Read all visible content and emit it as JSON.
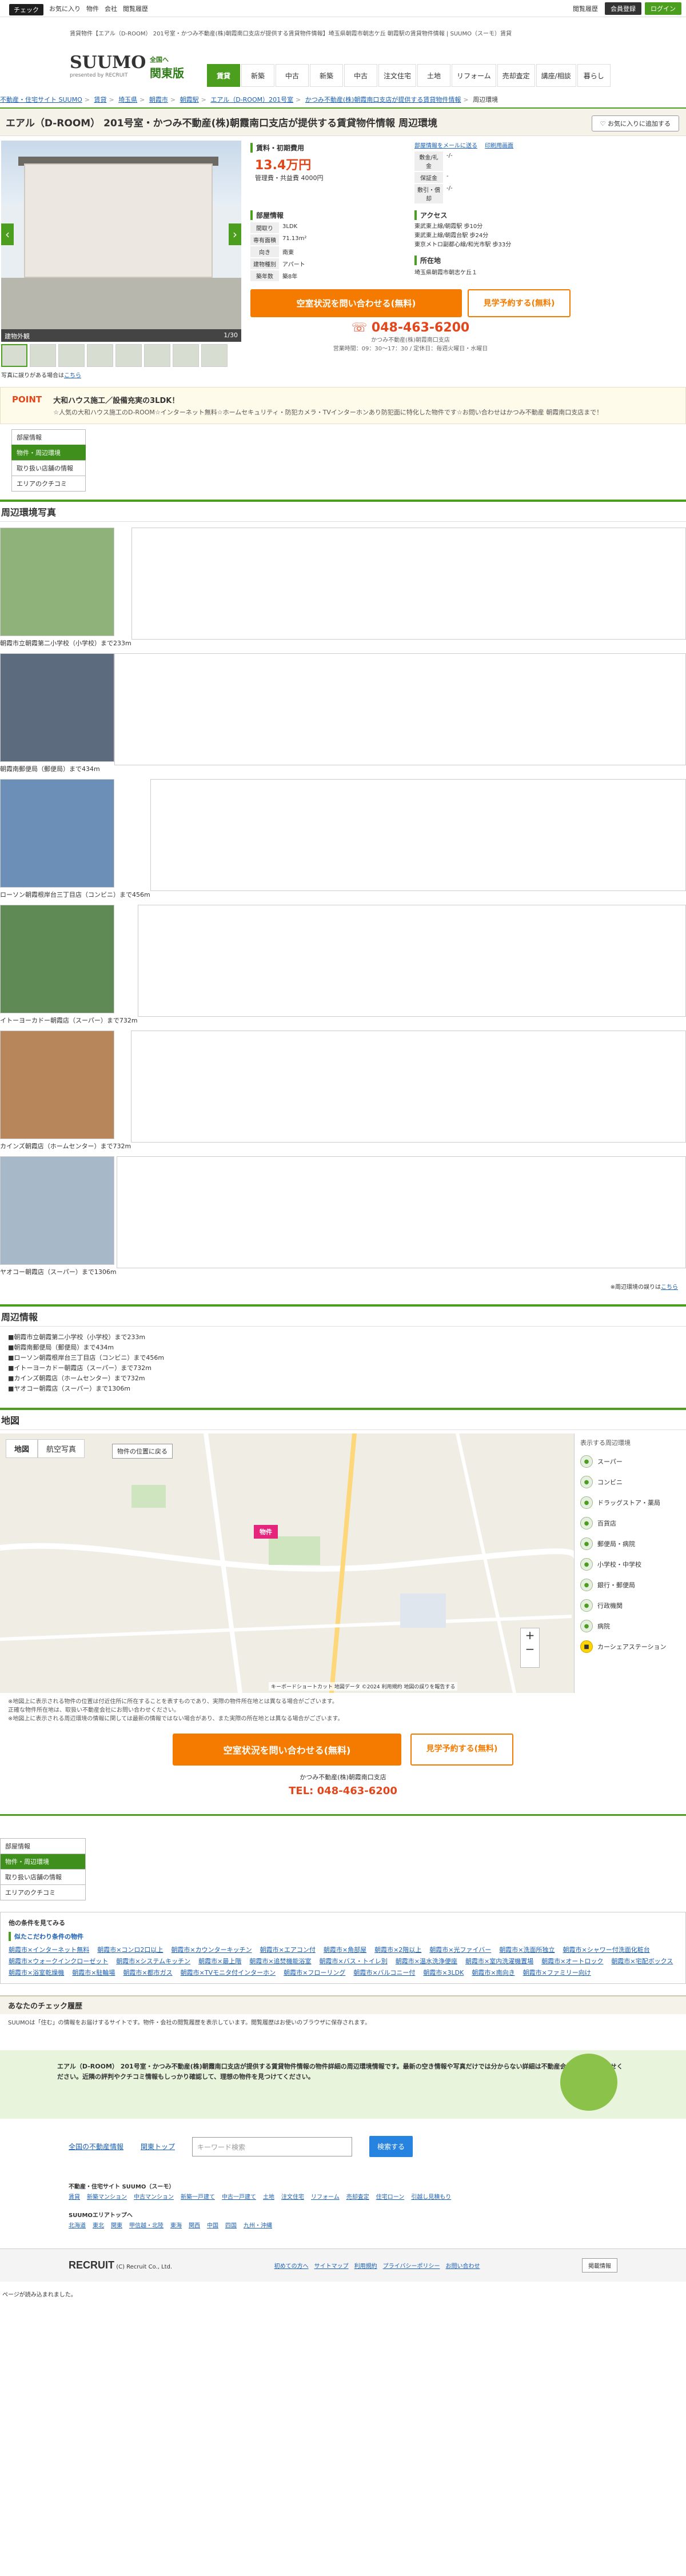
{
  "topbar": {
    "left": [
      "お気に入り",
      "物件",
      "会社",
      "閲覧履歴"
    ],
    "check": "チェック",
    "links": [
      "閲覧履歴"
    ],
    "member": "会員登録",
    "login": "ログイン"
  },
  "header": {
    "crumbline": "賃貸物件【エアル（D-ROOM） 201号室・かつみ不動産(株)朝霞南口支店が提供する賃貸物件情報】埼玉県朝霞市朝志ケ丘 朝霞駅の賃貸物件情報 | SUUMO（スーモ）賃貸",
    "logo": "SUUMO",
    "logo_sub": "presented by RECRUIT",
    "region": "関東版",
    "region_sub": "全国へ",
    "nav": [
      "賃貸",
      "新築",
      "中古",
      "新築",
      "中古",
      "注文住宅",
      "土地",
      "リフォーム",
      "売却査定",
      "講座/相談",
      "暮らし"
    ],
    "nav_active": 0
  },
  "breadcrumb": [
    "不動産・住宅サイト SUUMO",
    "賃貸",
    "埼玉県",
    "朝霞市",
    "朝霞駅",
    "エアル（D-ROOM）201号室",
    "かつみ不動産(株)朝霞南口支店が提供する賃貸物件情報",
    "周辺環境"
  ],
  "title": "エアル（D-ROOM） 201号室・かつみ不動産(株)朝霞南口支店が提供する賃貸物件情報 周辺環境",
  "fav_button": "お気に入りに追加する",
  "photo": {
    "caption": "建物外観",
    "counter": "1/30",
    "note": "写真に誤りがある場合は",
    "note_link": "こちら"
  },
  "fee": {
    "heading": "賃料・初期費用",
    "price": "13.4万円",
    "mgmt": "管理費・共益費 4000円",
    "rows": [
      {
        "k": "敷金/礼金",
        "v": "-/-"
      },
      {
        "k": "保証金",
        "v": "-"
      },
      {
        "k": "敷引・償却",
        "v": "-/-"
      }
    ]
  },
  "links_top": [
    "部屋情報をメールに送る",
    "印刷用画面"
  ],
  "room": {
    "heading": "部屋情報",
    "rows": [
      {
        "k": "間取り",
        "v": "3LDK"
      },
      {
        "k": "専有面積",
        "v": "71.13m²"
      },
      {
        "k": "向き",
        "v": "南東"
      },
      {
        "k": "建物種別",
        "v": "アパート"
      },
      {
        "k": "築年数",
        "v": "築8年"
      }
    ]
  },
  "access": {
    "heading": "アクセス",
    "lines": [
      "東武東上線/朝霞駅 歩10分",
      "東武東上線/朝霞台駅 歩24分",
      "東京メトロ副都心線/和光市駅 歩33分"
    ]
  },
  "location": {
    "heading": "所在地",
    "value": "埼玉県朝霞市朝志ケ丘１"
  },
  "cta": {
    "inquiry": "空室状況を問い合わせる(無料)",
    "visit": "見学予約する(無料)",
    "agent": "かつみ不動産(株)朝霞南口支店",
    "phone": "048-463-6200",
    "hours": "営業時間：09：30～17：30 / 定休日：毎週火曜日・水曜日"
  },
  "point": {
    "label": "POINT",
    "title": "大和ハウス施工／設備充実の3LDK！",
    "desc": "☆人気の大和ハウス施工のD-ROOM☆インターネット無料☆ホームセキュリティ・防犯カメラ・TVインターホンあり防犯面に特化した物件です☆お問い合わせはかつみ不動産 朝霞南口支店まで！"
  },
  "side_tabs": [
    "部屋情報",
    "物件・周辺環境",
    "取り扱い店舗の情報",
    "エリアのクチコミ"
  ],
  "side_tabs_active": 1,
  "env": {
    "heading": "周辺環境写真",
    "items": [
      "朝霞市立朝霞第二小学校（小学校）まで233m",
      "朝霞南郵便局（郵便局）まで434m",
      "ローソン朝霞根岸台三丁目店（コンビニ）まで456m",
      "イトーヨーカドー朝霞店（スーパー）まで732m",
      "カインズ朝霞店（ホームセンター）まで732m",
      "ヤオコー朝霞店（スーパー）まで1306m"
    ],
    "note": "※周辺環境の誤りは",
    "note_link": "こちら"
  },
  "env_info": {
    "heading": "周辺情報",
    "items": [
      "■朝霞市立朝霞第二小学校（小学校）まで233m",
      "■朝霞南郵便局（郵便局）まで434m",
      "■ローソン朝霞根岸台三丁目店（コンビニ）まで456m",
      "■イトーヨーカドー朝霞店（スーパー）まで732m",
      "■カインズ朝霞店（ホームセンター）まで732m",
      "■ヤオコー朝霞店（スーパー）まで1306m"
    ]
  },
  "map": {
    "heading": "地図",
    "tabs": [
      "地図",
      "航空写真"
    ],
    "reset": "物件の位置に戻る",
    "pin": "物件",
    "legend_title": "表示する周辺環境",
    "legend": [
      "スーパー",
      "コンビニ",
      "ドラッグストア・薬局",
      "百貨店",
      "郵便局・病院",
      "小学校・中学校",
      "銀行・郵便局",
      "行政機関",
      "病院",
      "カーシェアステーション"
    ],
    "attribution": "キーボードショートカット 地図データ ©2024 利用規約 地図の誤りを報告する"
  },
  "notes": [
    "※地図上に表示される物件の位置は付近住所に所在することを表すものであり、実際の物件所在地とは異なる場合がございます。",
    "正確な物件所在地は、取扱い不動産会社にお問い合わせください。",
    "※地図上に表示される周辺環境の情報に関しては最新の情報ではない場合があり、また実際の所在地とは異なる場合がございます。"
  ],
  "bottom_tabs": [
    "部屋情報",
    "物件・周辺環境",
    "取り扱い店舗の情報",
    "エリアのクチコミ"
  ],
  "bottom_tabs_active": 1,
  "other": {
    "heading": "他の条件を見てみる",
    "sub": "似たこだわり条件の物件",
    "links": [
      "朝霞市×インターネット無料",
      "朝霞市×コンロ2口以上",
      "朝霞市×カウンターキッチン",
      "朝霞市×エアコン付",
      "朝霞市×角部屋",
      "朝霞市×2階以上",
      "朝霞市×光ファイバー",
      "朝霞市×洗面所独立",
      "朝霞市×シャワー付洗面化粧台",
      "朝霞市×ウォークインクローゼット",
      "朝霞市×システムキッチン",
      "朝霞市×最上階",
      "朝霞市×追焚機能浴室",
      "朝霞市×バス・トイレ別",
      "朝霞市×温水洗浄便座",
      "朝霞市×室内洗濯機置場",
      "朝霞市×オートロック",
      "朝霞市×宅配ボックス",
      "朝霞市×浴室乾燥機",
      "朝霞市×駐輪場",
      "朝霞市×都市ガス",
      "朝霞市×TVモニタ付インターホン",
      "朝霞市×フローリング",
      "朝霞市×バルコニー付",
      "朝霞市×3LDK",
      "朝霞市×南向き",
      "朝霞市×ファミリー向け"
    ]
  },
  "history": {
    "heading": "あなたのチェック履歴",
    "note": "SUUMOは「住む」の情報をお届けするサイトです。物件・会社の閲覧履歴を表示しています。閲覧履歴はお使いのブラウザに保存されます。"
  },
  "banner": {
    "text": "エアル（D-ROOM） 201号室・かつみ不動産(株)朝霞南口支店が提供する賃貸物件情報の物件詳細の周辺環境情報です。最新の空き情報や写真だけでは分からない詳細は不動産会社にお問い合わせください。近隣の評判やクチコミ情報もしっかり確認して、理想の物件を見つけてください。"
  },
  "footer": {
    "links": [
      "全国の不動産情報",
      "関東トップ"
    ],
    "search_placeholder": "キーワード検索",
    "search_btn": "検索する",
    "group_title": "不動産・住宅サイト SUUMO（スーモ）",
    "group_links": [
      "賃貸",
      "新築マンション",
      "中古マンション",
      "新築一戸建て",
      "中古一戸建て",
      "土地",
      "注文住宅",
      "リフォーム",
      "売却査定",
      "住宅ローン",
      "引越し見積もり"
    ],
    "area_title": "SUUMOエリアトップへ",
    "area_links": [
      "北海道",
      "東北",
      "関東",
      "甲信越・北陸",
      "東海",
      "関西",
      "中国",
      "四国",
      "九州・沖縄"
    ],
    "company": "RECRUIT",
    "copyright": "(C) Recruit Co., Ltd.",
    "bottom_links": [
      "初めての方へ",
      "サイトマップ",
      "利用規約",
      "プライバシーポリシー",
      "お問い合わせ"
    ],
    "bottom_btn": "掲載情報"
  },
  "page_status": "ページが読み込まれました。"
}
